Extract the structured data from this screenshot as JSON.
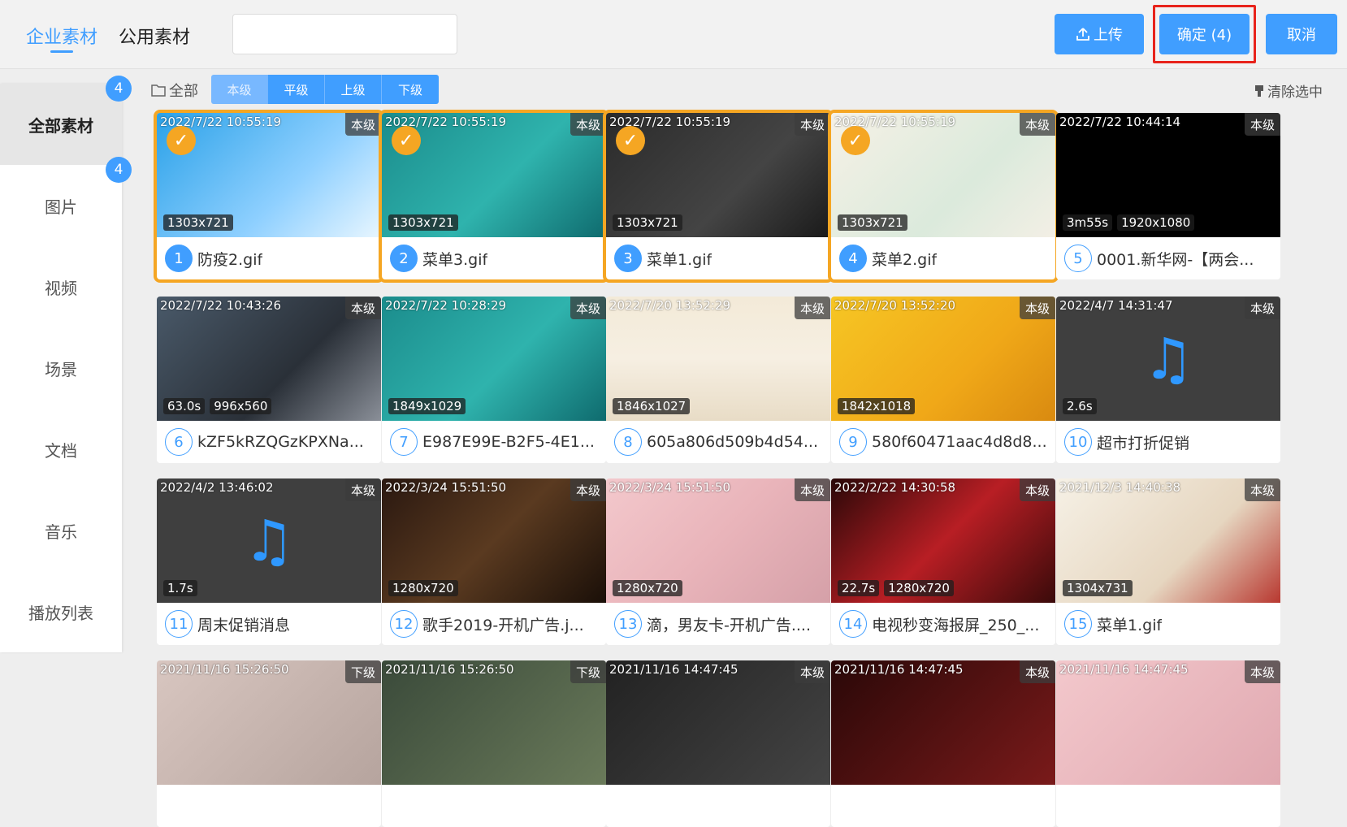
{
  "header": {
    "lib_tabs": [
      "企业素材",
      "公用素材"
    ],
    "search_placeholder": "",
    "upload_label": "上传",
    "confirm_label": "确定 (4)",
    "cancel_label": "取消"
  },
  "sidebar": {
    "items": [
      "全部素材",
      "图片",
      "视频",
      "场景",
      "文档",
      "音乐",
      "播放列表"
    ],
    "badges": [
      "4",
      "4"
    ]
  },
  "filter": {
    "all_label": "全部",
    "levels": [
      "本级",
      "平级",
      "上级",
      "下级"
    ],
    "clear_label": "清除选中"
  },
  "colors": {
    "accent": "#409eff",
    "selected": "#f5a623",
    "highlight": "#e8231b"
  },
  "cards": [
    {
      "ts": "2022/7/22 10:55:19",
      "level": "本级",
      "dims": [
        "1303x721"
      ],
      "num": "1",
      "name": "防疫2.gif",
      "selected": true
    },
    {
      "ts": "2022/7/22 10:55:19",
      "level": "本级",
      "dims": [
        "1303x721"
      ],
      "num": "2",
      "name": "菜单3.gif",
      "selected": true
    },
    {
      "ts": "2022/7/22 10:55:19",
      "level": "本级",
      "dims": [
        "1303x721"
      ],
      "num": "3",
      "name": "菜单1.gif",
      "selected": true
    },
    {
      "ts": "2022/7/22 10:55:19",
      "level": "本级",
      "dims": [
        "1303x721"
      ],
      "num": "4",
      "name": "菜单2.gif",
      "selected": true
    },
    {
      "ts": "2022/7/22 10:44:14",
      "level": "本级",
      "dims": [
        "3m55s",
        "1920x1080"
      ],
      "num": "5",
      "name": "0001.新华网-【两会...",
      "selected": false
    },
    {
      "ts": "2022/7/22 10:43:26",
      "level": "本级",
      "dims": [
        "63.0s",
        "996x560"
      ],
      "num": "6",
      "name": "kZF5kRZQGzKPXNa...",
      "selected": false
    },
    {
      "ts": "2022/7/22 10:28:29",
      "level": "本级",
      "dims": [
        "1849x1029"
      ],
      "num": "7",
      "name": "E987E99E-B2F5-4E1...",
      "selected": false
    },
    {
      "ts": "2022/7/20 13:52:29",
      "level": "本级",
      "dims": [
        "1846x1027"
      ],
      "num": "8",
      "name": "605a806d509b4d54...",
      "selected": false
    },
    {
      "ts": "2022/7/20 13:52:20",
      "level": "本级",
      "dims": [
        "1842x1018"
      ],
      "num": "9",
      "name": "580f60471aac4d8d8...",
      "selected": false
    },
    {
      "ts": "2022/4/7 14:31:47",
      "level": "本级",
      "dims": [
        "2.6s"
      ],
      "num": "10",
      "name": "超市打折促销",
      "selected": false,
      "audio": true
    },
    {
      "ts": "2022/4/2 13:46:02",
      "level": "本级",
      "dims": [
        "1.7s"
      ],
      "num": "11",
      "name": "周末促销消息",
      "selected": false,
      "audio": true
    },
    {
      "ts": "2022/3/24 15:51:50",
      "level": "本级",
      "dims": [
        "1280x720"
      ],
      "num": "12",
      "name": "歌手2019-开机广告.j...",
      "selected": false
    },
    {
      "ts": "2022/3/24 15:51:50",
      "level": "本级",
      "dims": [
        "1280x720"
      ],
      "num": "13",
      "name": "滴，男友卡-开机广告....",
      "selected": false
    },
    {
      "ts": "2022/2/22 14:30:58",
      "level": "本级",
      "dims": [
        "22.7s",
        "1280x720"
      ],
      "num": "14",
      "name": "电视秒变海报屏_250_...",
      "selected": false
    },
    {
      "ts": "2021/12/3 14:40:38",
      "level": "本级",
      "dims": [
        "1304x731"
      ],
      "num": "15",
      "name": "菜单1.gif",
      "selected": false
    },
    {
      "ts": "2021/11/16 15:26:50",
      "level": "下级",
      "dims": [],
      "num": "",
      "name": "",
      "selected": false
    },
    {
      "ts": "2021/11/16 15:26:50",
      "level": "下级",
      "dims": [],
      "num": "",
      "name": "",
      "selected": false
    },
    {
      "ts": "2021/11/16 14:47:45",
      "level": "本级",
      "dims": [],
      "num": "",
      "name": "",
      "selected": false
    },
    {
      "ts": "2021/11/16 14:47:45",
      "level": "本级",
      "dims": [],
      "num": "",
      "name": "",
      "selected": false
    },
    {
      "ts": "2021/11/16 14:47:45",
      "level": "本级",
      "dims": [],
      "num": "",
      "name": "",
      "selected": false
    }
  ]
}
